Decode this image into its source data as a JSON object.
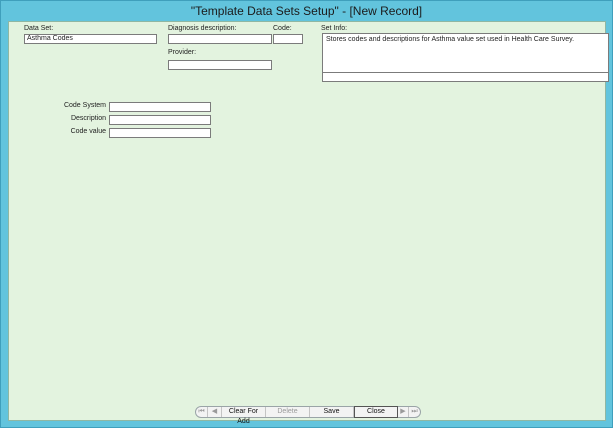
{
  "window": {
    "title": "\"Template Data Sets Setup\" - [New Record]"
  },
  "form": {
    "data_set_label": "Data Set:",
    "data_set_value": "Asthma Codes",
    "diagnosis_label": "Diagnosis description:",
    "diagnosis_value": "",
    "code_label": "Code:",
    "code_value": "",
    "set_info_label": "Set Info:",
    "set_info_value": "Stores codes and descriptions for Asthma value set used in Health Care Survey.",
    "provider_label": "Provider:",
    "provider_value": "",
    "code_system_label": "Code System",
    "code_system_value": "",
    "description_label": "Description",
    "description_value": "",
    "codevalue_label": "Code value",
    "codevalue_value": ""
  },
  "toolbar": {
    "first_icon": "⏮",
    "prev_icon": "◀",
    "clear_label": "Clear For Add",
    "delete_label": "Delete",
    "save_label": "Save",
    "close_label": "Close",
    "next_icon": "▶",
    "last_icon": "⏭"
  }
}
